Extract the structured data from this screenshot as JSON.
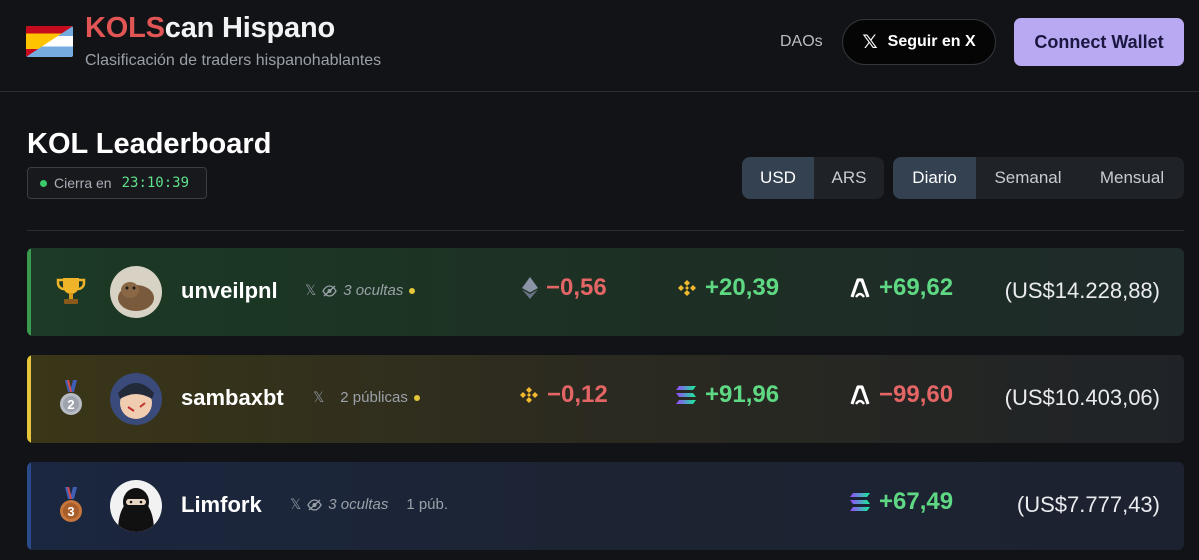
{
  "header": {
    "brand_prefix": "KOLS",
    "brand_suffix": "can Hispano",
    "subtitle": "Clasificación de traders hispanohablantes",
    "nav_daos": "DAOs",
    "follow_label": "Seguir en X",
    "connect_label": "Connect Wallet"
  },
  "leaderboard": {
    "title": "KOL Leaderboard",
    "timer_label": "Cierra en",
    "timer_value": "23:10:39",
    "currency_options": [
      "USD",
      "ARS"
    ],
    "currency_selected": "USD",
    "period_options": [
      "Diario",
      "Semanal",
      "Mensual"
    ],
    "period_selected": "Diario"
  },
  "rows": [
    {
      "rank_icon": "trophy-icon",
      "name": "unveilpnl",
      "hidden": "3 ocultas",
      "v1_icon": "ethereum-icon",
      "v1": "−0,56",
      "v2_icon": "bnb-icon",
      "v2": "+20,39",
      "v3_icon": "abstract-icon",
      "v3": "+69,62",
      "total": "(US$14.228,88)"
    },
    {
      "rank_icon": "silver-medal-icon",
      "name": "sambaxbt",
      "public": "2 públicas",
      "v1_icon": "bnb-icon",
      "v1": "−0,12",
      "v2_icon": "solana-icon",
      "v2": "+91,96",
      "v3_icon": "abstract-icon",
      "v3": "−99,60",
      "total": "(US$10.403,06)"
    },
    {
      "rank_icon": "bronze-medal-icon",
      "name": "Limfork",
      "hidden": "3 ocultas",
      "public": "1 púb.",
      "v3_icon": "solana-icon",
      "v3": "+67,49",
      "total": "(US$7.777,43)"
    }
  ],
  "colors": {
    "accent": "#b8a9f2",
    "positive": "#5fd883",
    "negative": "#e46565",
    "brand_red": "#e25555"
  }
}
